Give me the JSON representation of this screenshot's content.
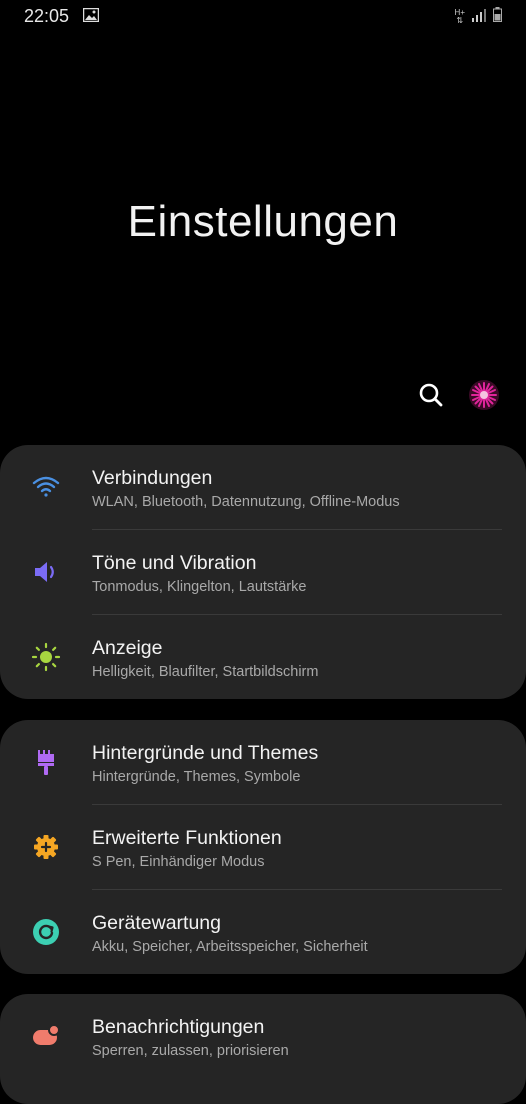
{
  "status_bar": {
    "time": "22:05",
    "network": "H+"
  },
  "header": {
    "title": "Einstellungen"
  },
  "colors": {
    "wifi": "#4a90e2",
    "sound": "#7b6cf6",
    "display": "#a8d640",
    "themes": "#b06af3",
    "advanced": "#f5a623",
    "care": "#3ccfb2",
    "notif": "#f07c6c"
  },
  "groups": [
    {
      "items": [
        {
          "title": "Verbindungen",
          "subtitle": "WLAN, Bluetooth, Datennutzung, Offline-Modus",
          "icon": "wifi-icon"
        },
        {
          "title": "Töne und Vibration",
          "subtitle": "Tonmodus, Klingelton, Lautstärke",
          "icon": "volume-icon"
        },
        {
          "title": "Anzeige",
          "subtitle": "Helligkeit, Blaufilter, Startbildschirm",
          "icon": "brightness-icon"
        }
      ]
    },
    {
      "items": [
        {
          "title": "Hintergründe und Themes",
          "subtitle": "Hintergründe, Themes, Symbole",
          "icon": "paintbrush-icon"
        },
        {
          "title": "Erweiterte Funktionen",
          "subtitle": "S Pen, Einhändiger Modus",
          "icon": "gear-plus-icon"
        },
        {
          "title": "Gerätewartung",
          "subtitle": "Akku, Speicher, Arbeitsspeicher, Sicherheit",
          "icon": "device-care-icon"
        }
      ]
    },
    {
      "items": [
        {
          "title": "Benachrichtigungen",
          "subtitle": "Sperren, zulassen, priorisieren",
          "icon": "notification-icon"
        }
      ]
    }
  ]
}
